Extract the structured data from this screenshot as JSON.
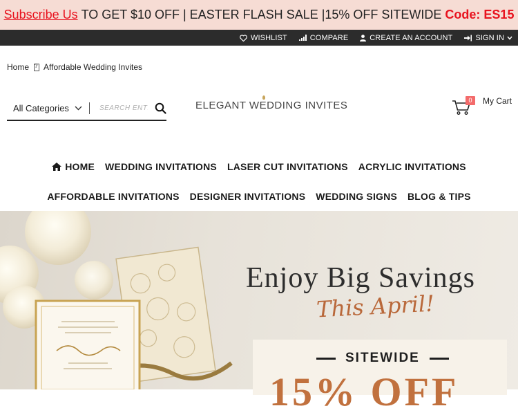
{
  "promo": {
    "link": "Subscribe Us",
    "text": "TO GET $10 OFF | EASTER FLASH SALE |15% OFF SITEWIDE",
    "code": "Code: ES15"
  },
  "topbar": {
    "wishlist": "WISHLIST",
    "compare": "COMPARE",
    "create_account": "CREATE AN ACCOUNT",
    "sign_in": "SIGN IN"
  },
  "breadcrumb": {
    "home": "Home",
    "current": "Affordable Wedding Invites"
  },
  "search": {
    "category": "All Categories",
    "placeholder": "SEARCH ENTIRE STORE HERE..."
  },
  "logo": {
    "part1": "ELEGANT W",
    "part2": "E",
    "part3": "DDING INVITES"
  },
  "cart": {
    "count": "0",
    "label": "My Cart"
  },
  "nav": {
    "row1": [
      "HOME",
      "WEDDING INVITATIONS",
      "LASER CUT INVITATIONS",
      "ACRYLIC INVITATIONS"
    ],
    "row2": [
      "AFFORDABLE INVITATIONS",
      "DESIGNER INVITATIONS",
      "WEDDING SIGNS",
      "BLOG & TIPS"
    ]
  },
  "hero": {
    "headline": "Enjoy Big Savings",
    "script": "This April!",
    "sitewide": "SITEWIDE",
    "discount": "15% OFF"
  },
  "colors": {
    "promo_bg": "#f6dcd4",
    "accent_red": "#e8121e",
    "topbar_bg": "#2c2c2c",
    "cart_badge": "#f36b6b",
    "hero_orange": "#c1713e"
  }
}
